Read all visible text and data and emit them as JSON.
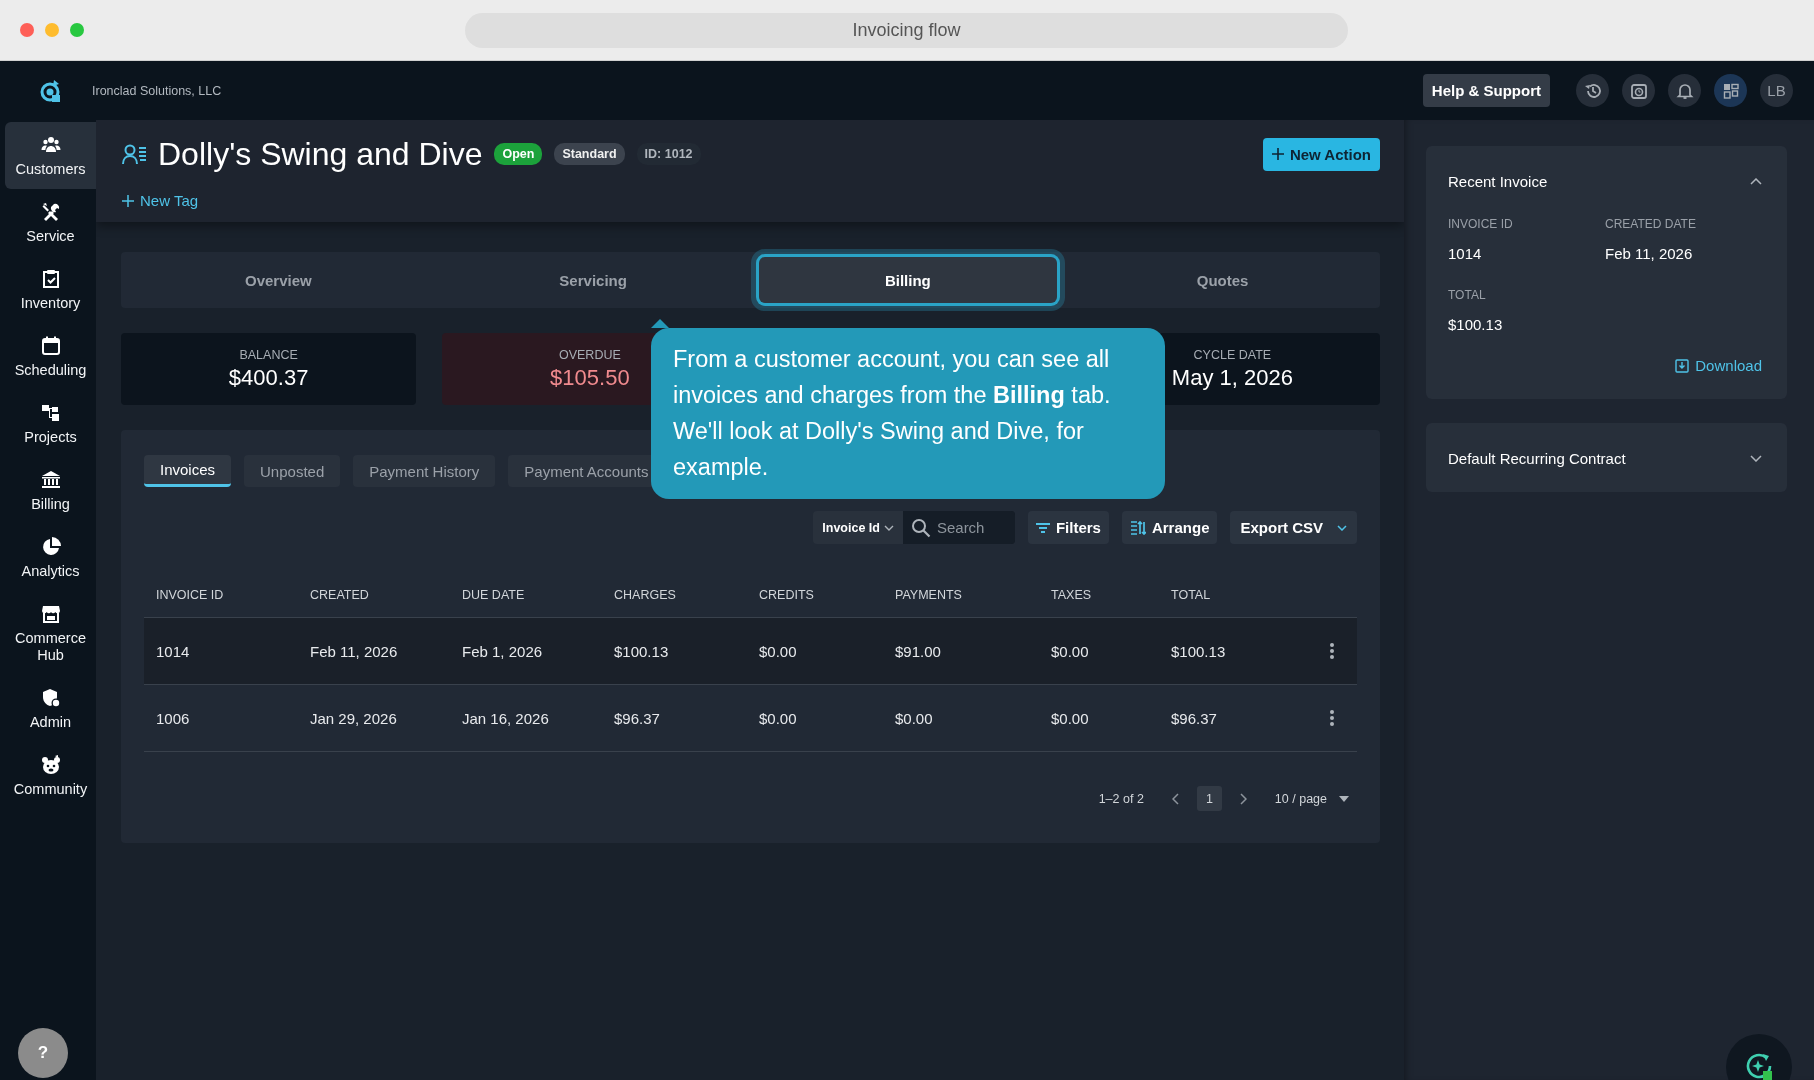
{
  "browser": {
    "title": "Invoicing flow"
  },
  "top_bar": {
    "company": "Ironclad Solutions, LLC",
    "help_button": "Help & Support",
    "avatar": "LB"
  },
  "sidebar": {
    "items": [
      {
        "label": "Customers",
        "selected": true
      },
      {
        "label": "Service",
        "selected": false
      },
      {
        "label": "Inventory",
        "selected": false
      },
      {
        "label": "Scheduling",
        "selected": false
      },
      {
        "label": "Projects",
        "selected": false
      },
      {
        "label": "Billing",
        "selected": false
      },
      {
        "label": "Analytics",
        "selected": false
      },
      {
        "label": "Commerce Hub",
        "selected": false
      },
      {
        "label": "Admin",
        "selected": false
      },
      {
        "label": "Community",
        "selected": false
      }
    ],
    "help_button": "?"
  },
  "customer": {
    "name": "Dolly's Swing and Dive",
    "status": "Open",
    "plan": "Standard",
    "id": "ID: 1012",
    "new_tag": "New Tag",
    "new_action": "New Action"
  },
  "tabs": [
    {
      "label": "Overview",
      "selected": false,
      "highlighted": false
    },
    {
      "label": "Servicing",
      "selected": false,
      "highlighted": false
    },
    {
      "label": "Billing",
      "selected": true,
      "highlighted": true
    },
    {
      "label": "Quotes",
      "selected": false,
      "highlighted": false
    }
  ],
  "summary_cards": [
    {
      "label": "BALANCE",
      "value": "$400.37",
      "kind": "normal"
    },
    {
      "label": "OVERDUE",
      "value": "$105.50",
      "kind": "alert"
    },
    {
      "label": "CYCLE DATE",
      "value": "May 1, 2026",
      "kind": "normal"
    }
  ],
  "invoice_tabs": [
    {
      "label": "Invoices",
      "selected": true
    },
    {
      "label": "Unposted",
      "selected": false
    },
    {
      "label": "Payment History",
      "selected": false
    },
    {
      "label": "Payment Accounts",
      "selected": false
    }
  ],
  "toolbar": {
    "search_by": "Invoice Id",
    "search_placeholder": "Search",
    "filters": "Filters",
    "arrange": "Arrange",
    "export": "Export CSV"
  },
  "table": {
    "columns": [
      "INVOICE ID",
      "CREATED",
      "DUE DATE",
      "CHARGES",
      "CREDITS",
      "PAYMENTS",
      "TAXES",
      "TOTAL"
    ],
    "rows": [
      {
        "cells": [
          "1014",
          "Feb 11, 2026",
          "Feb 1, 2026",
          "$100.13",
          "$0.00",
          "$91.00",
          "$0.00",
          "$100.13"
        ],
        "highlighted": true
      },
      {
        "cells": [
          "1006",
          "Jan 29, 2026",
          "Jan 16, 2026",
          "$96.37",
          "$0.00",
          "$0.00",
          "$0.00",
          "$96.37"
        ],
        "highlighted": false
      }
    ]
  },
  "pagination": {
    "range": "1–2 of 2",
    "page": "1",
    "page_size": "10 / page"
  },
  "right_panels": [
    {
      "title": "Recent Invoice",
      "expanded": true,
      "fields": [
        {
          "label": "INVOICE ID",
          "value": "1014"
        },
        {
          "label": "CREATED DATE",
          "value": "Feb 11, 2026"
        },
        {
          "label": "TOTAL",
          "value": "$100.13"
        }
      ],
      "action": "Download"
    },
    {
      "title": "Default Recurring Contract",
      "expanded": false
    }
  ],
  "tour_tooltip": {
    "text": "From a customer account, you can see all invoices and charges from the **Billing** tab. We'll look at Dolly's Swing and Dive, for example."
  }
}
